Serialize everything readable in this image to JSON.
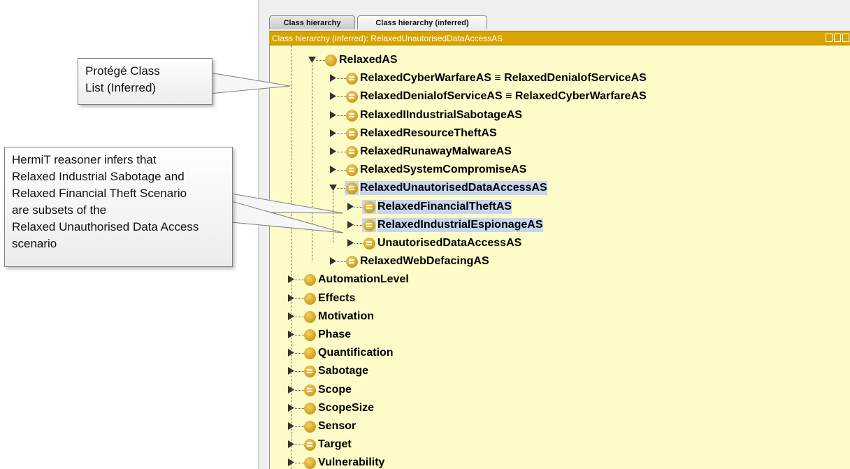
{
  "tabs": [
    {
      "label": "Class hierarchy",
      "active": false
    },
    {
      "label": "Class hierarchy (inferred)",
      "active": true
    }
  ],
  "view_title": "Class hierarchy (inferred): RelaxedUnautorisedDataAccessAS",
  "tree": [
    {
      "label": "RelaxedAS",
      "level": 0,
      "expanded": true,
      "icon": "class-icon"
    },
    {
      "label": "RelaxedCyberWarfareAS ≡ RelaxedDenialofServiceAS",
      "level": 1,
      "expanded": false,
      "icon": "defined-class-icon"
    },
    {
      "label": "RelaxedDenialofServiceAS ≡ RelaxedCyberWarfareAS",
      "level": 1,
      "expanded": false,
      "icon": "defined-class-icon"
    },
    {
      "label": "RelaxedIIndustrialSabotageAS",
      "level": 1,
      "expanded": false,
      "icon": "defined-class-icon"
    },
    {
      "label": "RelaxedResourceTheftAS",
      "level": 1,
      "expanded": false,
      "icon": "defined-class-icon"
    },
    {
      "label": "RelaxedRunawayMalwareAS",
      "level": 1,
      "expanded": false,
      "icon": "defined-class-icon"
    },
    {
      "label": "RelaxedSystemCompromiseAS",
      "level": 1,
      "expanded": false,
      "icon": "defined-class-icon"
    },
    {
      "label": "RelaxedUnautorisedDataAccessAS",
      "level": 1,
      "expanded": true,
      "icon": "defined-class-icon",
      "highlighted": true
    },
    {
      "label": "RelaxedFinancialTheftAS",
      "level": 2,
      "expanded": false,
      "icon": "defined-class-icon",
      "highlighted": true
    },
    {
      "label": "RelaxedIndustrialEspionageAS",
      "level": 2,
      "expanded": false,
      "icon": "defined-class-icon",
      "highlighted": true
    },
    {
      "label": "UnautorisedDataAccessAS",
      "level": 2,
      "expanded": false,
      "icon": "defined-class-icon"
    },
    {
      "label": "RelaxedWebDefacingAS",
      "level": 1,
      "expanded": false,
      "icon": "defined-class-icon"
    },
    {
      "label": "AutomationLevel",
      "level": -1,
      "expanded": false,
      "icon": "class-icon"
    },
    {
      "label": "Effects",
      "level": -1,
      "expanded": false,
      "icon": "class-icon"
    },
    {
      "label": "Motivation",
      "level": -1,
      "expanded": false,
      "icon": "class-icon"
    },
    {
      "label": "Phase",
      "level": -1,
      "expanded": false,
      "icon": "class-icon"
    },
    {
      "label": "Quantification",
      "level": -1,
      "expanded": false,
      "icon": "class-icon"
    },
    {
      "label": "Sabotage",
      "level": -1,
      "expanded": false,
      "icon": "defined-class-icon"
    },
    {
      "label": "Scope",
      "level": -1,
      "expanded": false,
      "icon": "defined-class-icon"
    },
    {
      "label": "ScopeSize",
      "level": -1,
      "expanded": false,
      "icon": "class-icon"
    },
    {
      "label": "Sensor",
      "level": -1,
      "expanded": false,
      "icon": "class-icon"
    },
    {
      "label": "Target",
      "level": -1,
      "expanded": false,
      "icon": "defined-class-icon"
    },
    {
      "label": "Vulnerability",
      "level": -1,
      "expanded": false,
      "icon": "class-icon"
    }
  ],
  "callouts": {
    "protege": {
      "line1": "Protégé Class",
      "line2": "List (Inferred)"
    },
    "hermit": {
      "line1": "HermiT reasoner infers that",
      "line2": "Relaxed Industrial Sabotage  and",
      "line3": "Relaxed Financial Theft Scenario",
      "line4": "are subsets of the",
      "line5": "Relaxed Unauthorised Data Access",
      "line6": "scenario"
    }
  },
  "colors": {
    "title_bar": "#d8a200",
    "tree_background": "#fdfbc8",
    "selection": "#c7d6ee",
    "class_icon": "#d7a422"
  }
}
